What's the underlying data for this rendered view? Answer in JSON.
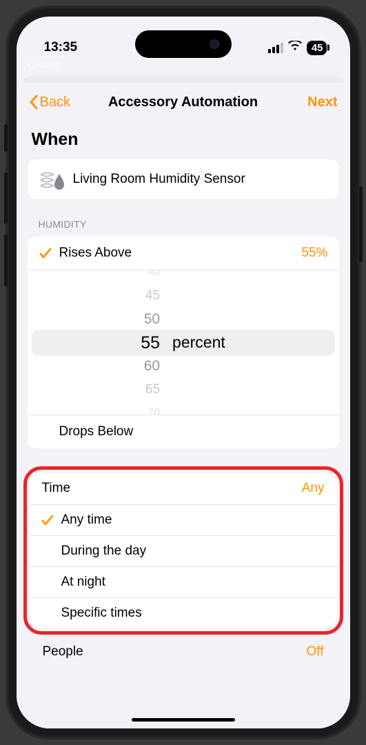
{
  "status": {
    "time": "13:35",
    "battery": "45",
    "breadcrumb": "Search"
  },
  "nav": {
    "back": "Back",
    "title": "Accessory Automation",
    "next": "Next"
  },
  "section_title": "When",
  "sensor": {
    "name": "Living Room Humidity Sensor"
  },
  "humidity": {
    "header": "HUMIDITY",
    "rises_label": "Rises Above",
    "rises_value": "55%",
    "drops_label": "Drops Below",
    "unit": "percent",
    "picker": {
      "v0": "40",
      "v1": "45",
      "v2": "50",
      "sel": "55",
      "v4": "60",
      "v5": "65",
      "v6": "70"
    }
  },
  "time": {
    "header": "Time",
    "value": "Any",
    "opt0": "Any time",
    "opt1": "During the day",
    "opt2": "At night",
    "opt3": "Specific times"
  },
  "people": {
    "header": "People",
    "value": "Off"
  }
}
